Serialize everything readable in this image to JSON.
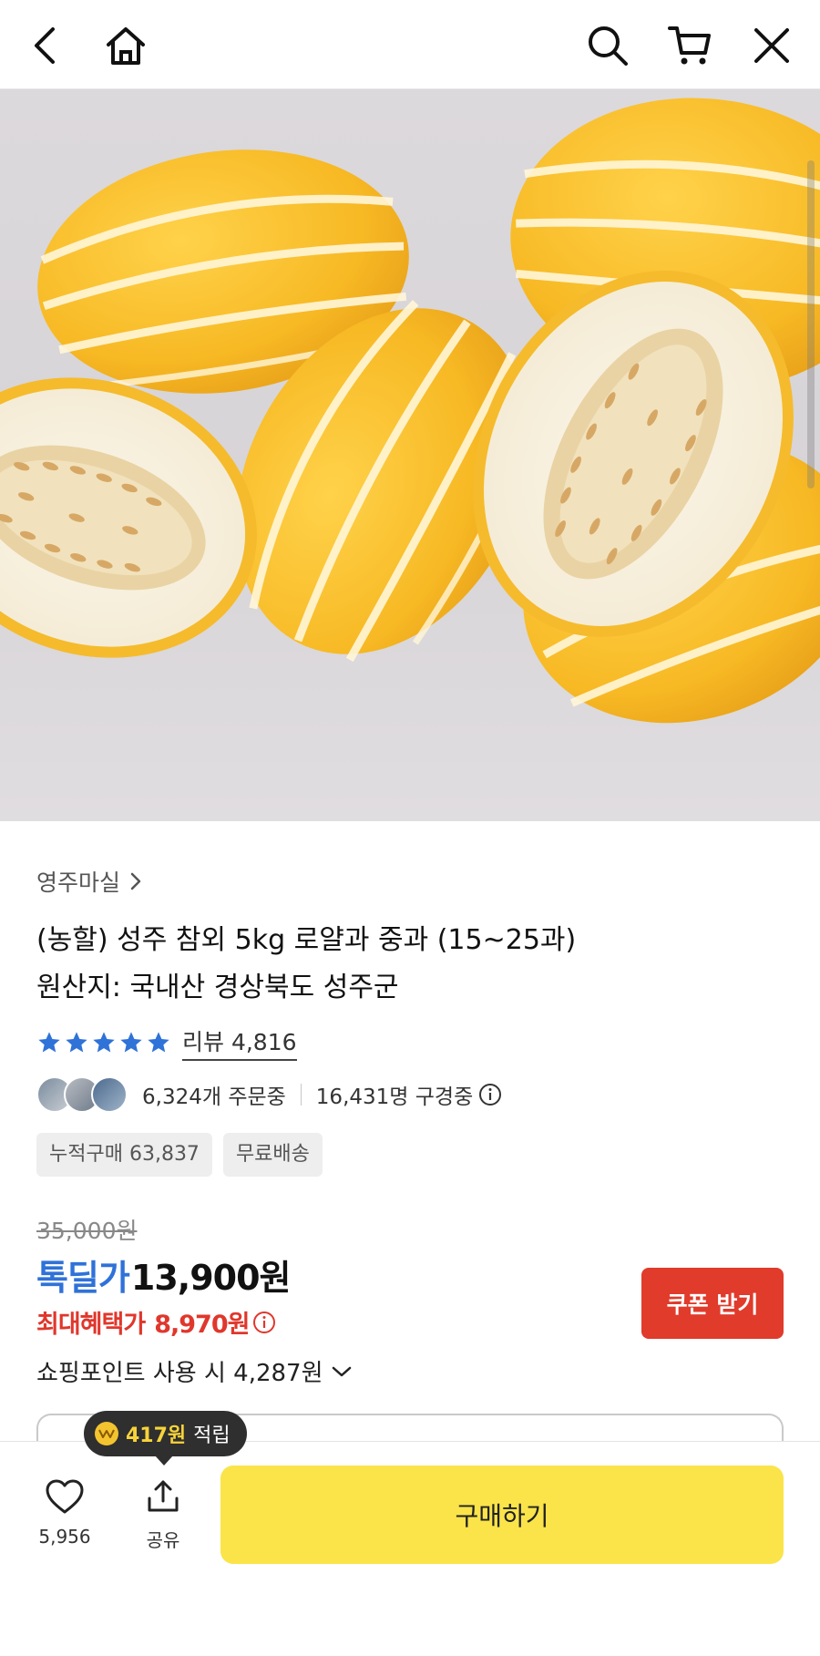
{
  "nav": {
    "back_icon": "chevron-left-icon",
    "home_icon": "home-icon",
    "search_icon": "search-icon",
    "cart_icon": "cart-icon",
    "close_icon": "close-icon"
  },
  "product": {
    "store_name": "영주마실",
    "title_line1": "(농할) 성주 참외 5kg 로얄과 중과 (15~25과)",
    "title_line2": "원산지: 국내산 경상북도 성주군",
    "rating_stars": 5,
    "review_label": "리뷰 4,816",
    "orders_text": "6,324개 주문중",
    "viewers_text": "16,431명 구경중",
    "chips": [
      "누적구매 63,837",
      "무료배송"
    ],
    "original_price": "35,000원",
    "deal_label": "톡딜가",
    "deal_price": "13,900원",
    "max_benefit_label": "최대혜택가",
    "max_benefit_price": "8,970원",
    "coupon_button": "쿠폰 받기",
    "points_text": "쇼핑포인트 사용 시 4,287원"
  },
  "tooltip": {
    "amount": "417원",
    "suffix": "적립"
  },
  "bottom_bar": {
    "wish_count": "5,956",
    "share_label": "공유",
    "buy_button": "구매하기"
  },
  "colors": {
    "deal_blue": "#2f72d8",
    "benefit_red": "#e0372c",
    "coupon_red": "#e03b2b",
    "buy_yellow": "#fae44a",
    "star_blue": "#2f72d8"
  }
}
